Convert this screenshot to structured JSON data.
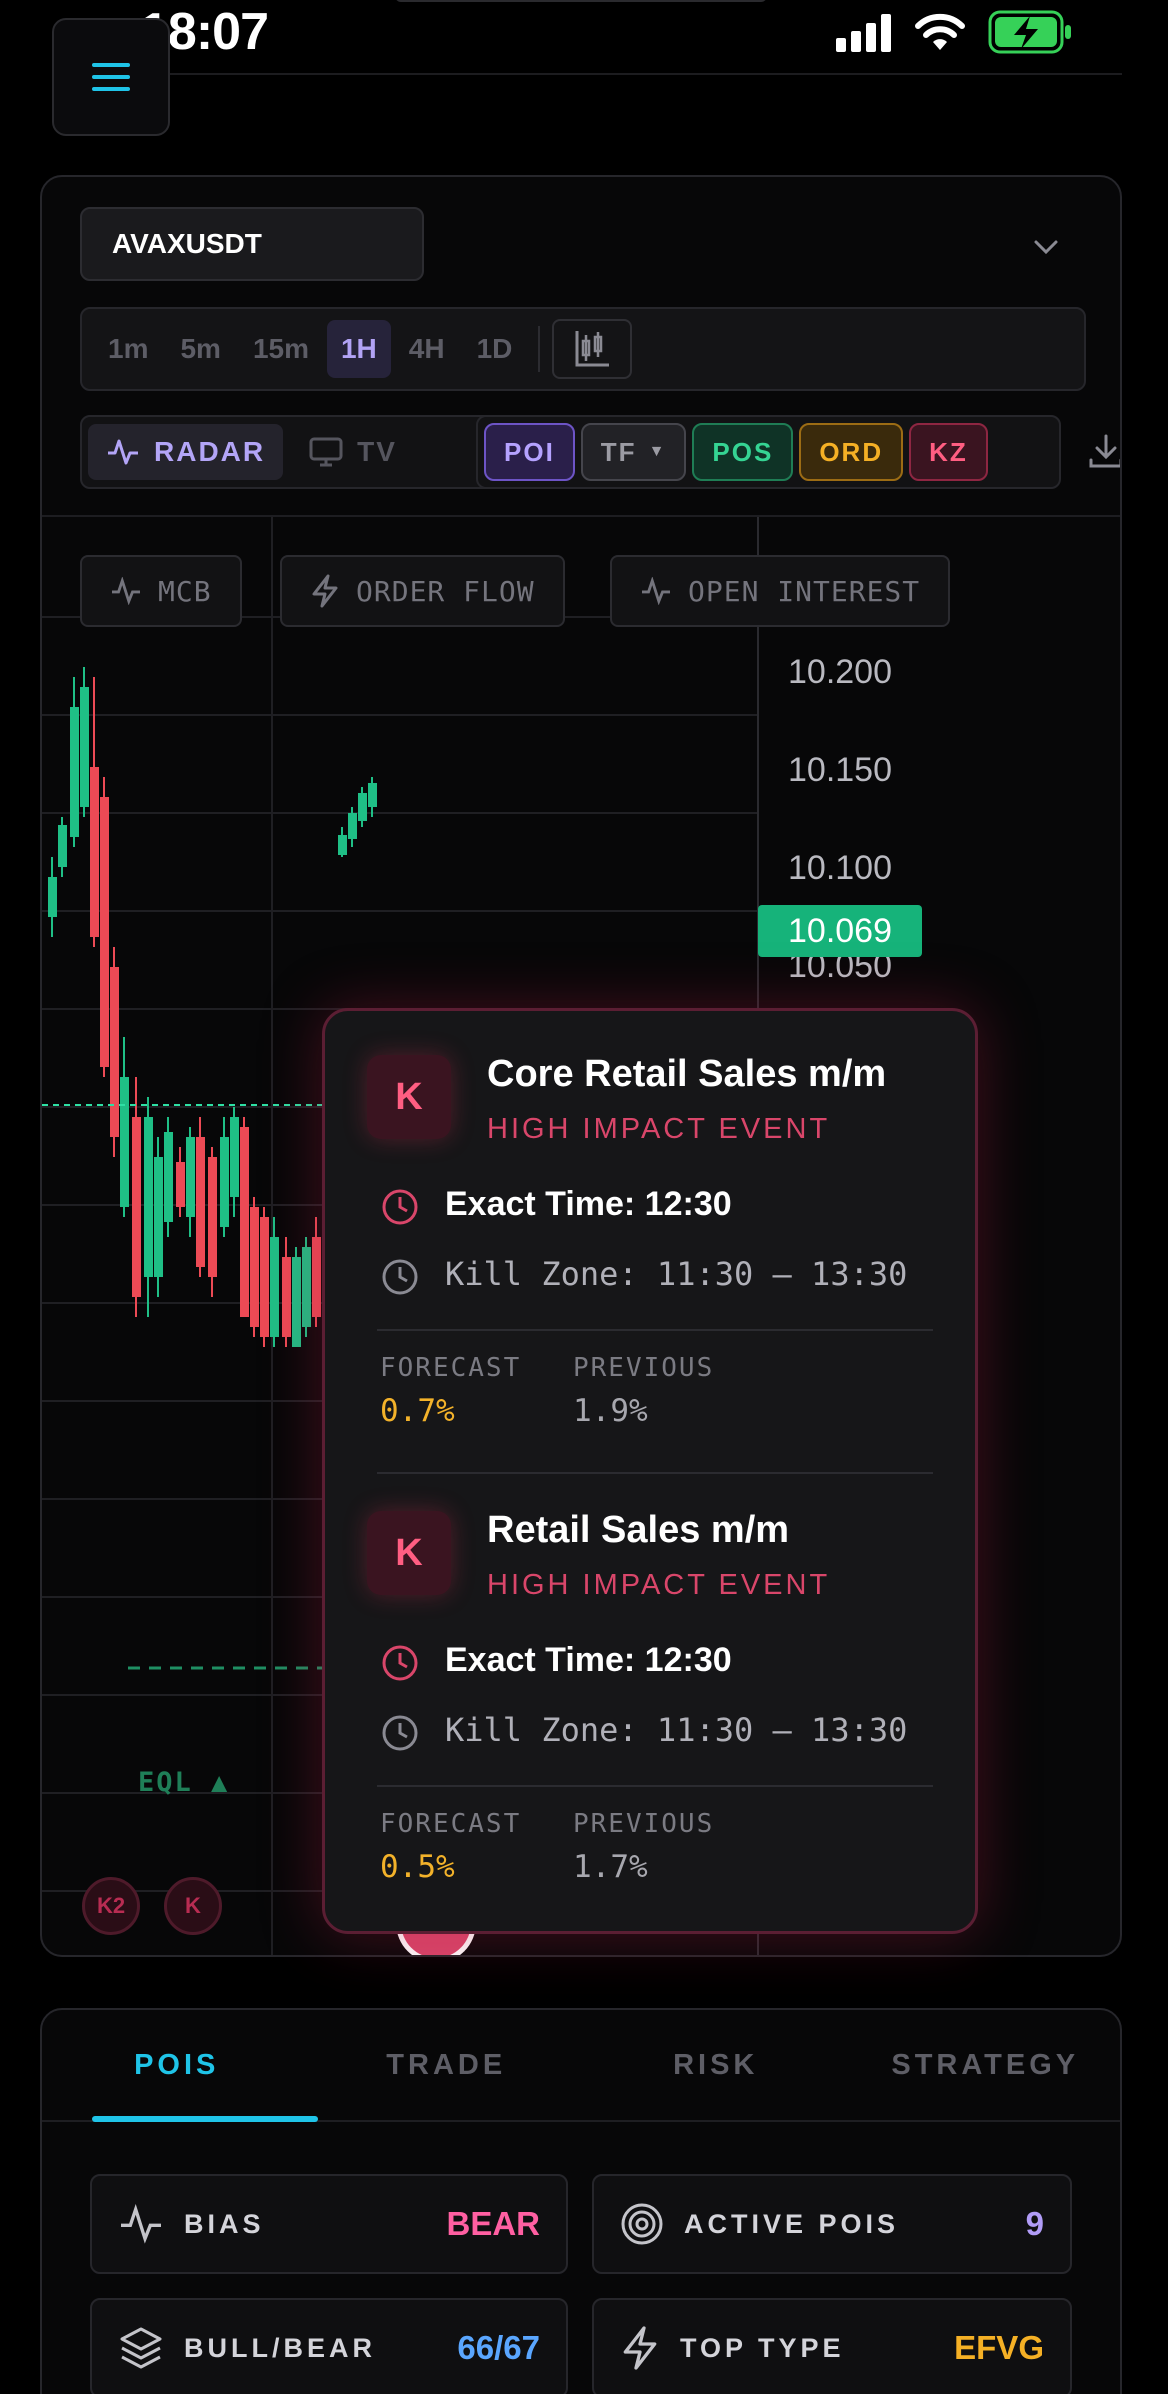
{
  "status_bar": {
    "time": "18:07"
  },
  "symbol": {
    "value": "AVAXUSDT"
  },
  "timeframes": [
    "1m",
    "5m",
    "15m",
    "1H",
    "4H",
    "1D"
  ],
  "active_timeframe": "1H",
  "modes": {
    "radar": "RADAR",
    "tv": "TV",
    "active": "RADAR"
  },
  "tags": {
    "poi": "POI",
    "tf": "TF",
    "pos": "POS",
    "ord": "ORD",
    "kz": "KZ"
  },
  "indicators": {
    "mcb": "MCB",
    "order_flow": "ORDER FLOW",
    "open_interest": "OPEN INTEREST"
  },
  "price_axis": [
    "10.200",
    "10.150",
    "10.100",
    "10.050"
  ],
  "current_price": "10.069",
  "chart_markers": {
    "eql": "EQL ▲",
    "k2": "K2",
    "k": "K"
  },
  "events": [
    {
      "badge": "K",
      "title": "Core Retail Sales m/m",
      "impact": "HIGH IMPACT EVENT",
      "exact_time": "Exact Time: 12:30",
      "kill_zone": "Kill Zone: 11:30 – 13:30",
      "forecast_label": "FORECAST",
      "forecast": "0.7%",
      "previous_label": "PREVIOUS",
      "previous": "1.9%"
    },
    {
      "badge": "K",
      "title": "Retail Sales m/m",
      "impact": "HIGH IMPACT EVENT",
      "exact_time": "Exact Time: 12:30",
      "kill_zone": "Kill Zone: 11:30 – 13:30",
      "forecast_label": "FORECAST",
      "forecast": "0.5%",
      "previous_label": "PREVIOUS",
      "previous": "1.7%"
    }
  ],
  "panel_tabs": [
    "POIS",
    "TRADE",
    "RISK",
    "STRATEGY"
  ],
  "active_panel_tab": "POIS",
  "stats": [
    {
      "label": "BIAS",
      "value": "BEAR",
      "color": "#ff5fa2",
      "icon": "pulse-icon"
    },
    {
      "label": "ACTIVE POIS",
      "value": "9",
      "color": "#b19cf7",
      "icon": "target-icon"
    },
    {
      "label": "BULL/BEAR",
      "value": "66/67",
      "color": "#5aa6ff",
      "icon": "layers-icon"
    },
    {
      "label": "TOP TYPE",
      "value": "EFVG",
      "color": "#f5b025",
      "icon": "bolt-icon"
    }
  ],
  "colors": {
    "bull": "#1fbf86",
    "bear": "#ec4a55",
    "accent": "#1fc4e8",
    "impact": "#d9466a"
  }
}
